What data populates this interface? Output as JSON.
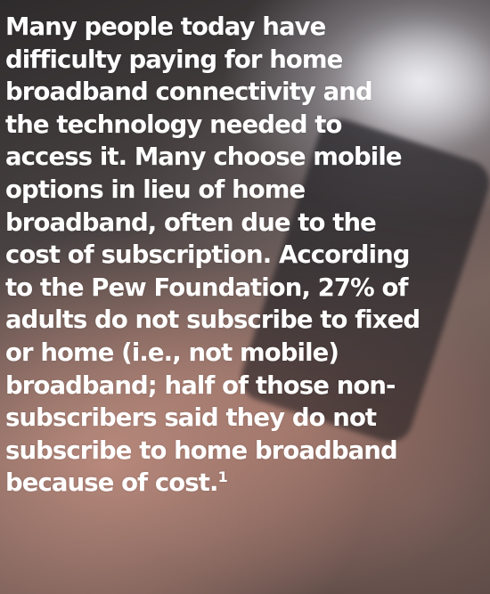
{
  "content": {
    "paragraph": "Many people today have\ndifficulty paying for home\nbroadband connectivity and\nthe technology needed to\naccess it. Many choose mobile\noptions in lieu of home\nbroadband, often due to the\ncost of subscription. According\nto the Pew Foundation, 27% of\nadults do not subscribe to fixed\nor home (i.e., not mobile)\nbroadband; half of those non-\nsubscribers said they do not\nsubscribe to home broadband\nbecause of cost.",
    "footnote_marker": "1"
  },
  "background": {
    "image": "blurred-hand-holding-phone"
  }
}
